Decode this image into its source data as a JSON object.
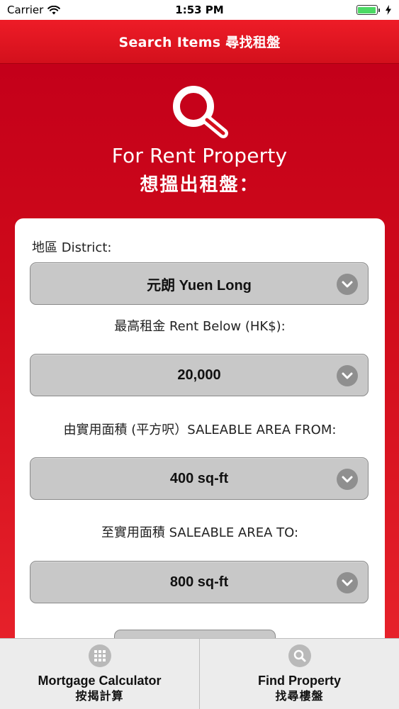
{
  "status": {
    "carrier": "Carrier",
    "time": "1:53 PM"
  },
  "nav": {
    "title": "Search Items 尋找租盤"
  },
  "hero": {
    "title_en": "For Rent Property",
    "title_zh": "想搵出租盤："
  },
  "form": {
    "district": {
      "label": "地區 District:",
      "value": "元朗 Yuen Long"
    },
    "rent": {
      "label": "最高租金 Rent Below (HK$):",
      "value": "20,000"
    },
    "area_from": {
      "label": "由實用面積 (平方呎）SALEABLE AREA FROM:",
      "value": "400 sq-ft"
    },
    "area_to": {
      "label": "至實用面積 SALEABLE AREA TO:",
      "value": "800 sq-ft"
    }
  },
  "tabs": [
    {
      "en": "Mortgage Calculator",
      "zh": "按揭計算",
      "icon": "calculator-icon"
    },
    {
      "en": "Find Property",
      "zh": "找尋樓盤",
      "icon": "search-icon"
    }
  ],
  "colors": {
    "brand_red": "#d3101c",
    "select_gray": "#c8c8c8"
  }
}
